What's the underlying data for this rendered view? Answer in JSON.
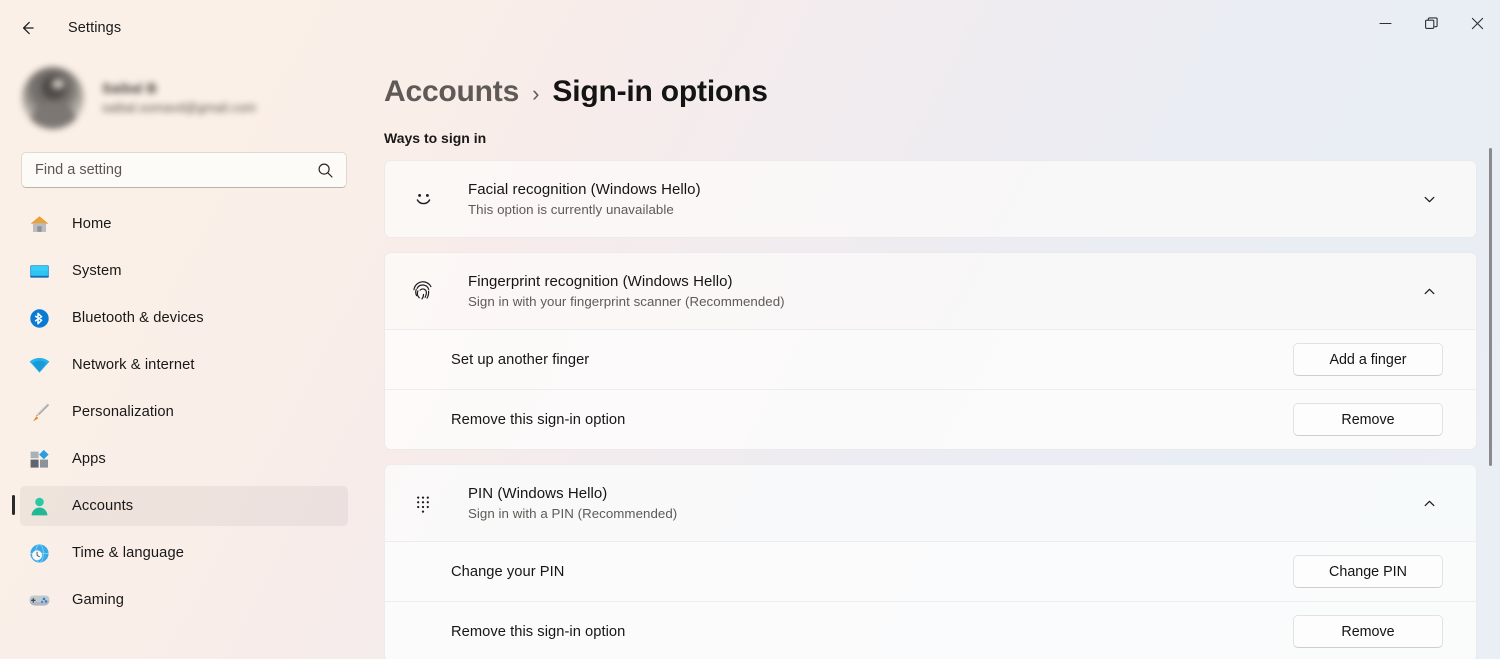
{
  "window": {
    "app_title": "Settings",
    "back_icon": "back-arrow-icon",
    "controls": {
      "minimize": "minimize-icon",
      "maximize": "restore-icon",
      "close": "close-icon"
    }
  },
  "sidebar": {
    "profile": {
      "name": "Saibal B",
      "email": "saibal.somavd@gmail.com",
      "avatar": "user-avatar"
    },
    "search": {
      "placeholder": "Find a setting",
      "value": "",
      "icon": "search-icon"
    },
    "items": [
      {
        "label": "Home",
        "icon": "home-icon",
        "selected": false
      },
      {
        "label": "System",
        "icon": "system-icon",
        "selected": false
      },
      {
        "label": "Bluetooth & devices",
        "icon": "bluetooth-icon",
        "selected": false
      },
      {
        "label": "Network & internet",
        "icon": "wifi-icon",
        "selected": false
      },
      {
        "label": "Personalization",
        "icon": "paintbrush-icon",
        "selected": false
      },
      {
        "label": "Apps",
        "icon": "apps-icon",
        "selected": false
      },
      {
        "label": "Accounts",
        "icon": "accounts-icon",
        "selected": true
      },
      {
        "label": "Time & language",
        "icon": "clock-globe-icon",
        "selected": false
      },
      {
        "label": "Gaming",
        "icon": "gamepad-icon",
        "selected": false
      }
    ]
  },
  "main": {
    "breadcrumb": {
      "parent": "Accounts",
      "separator": "›",
      "current": "Sign-in options"
    },
    "section_title": "Ways to sign in",
    "cards": [
      {
        "icon": "face-smile-icon",
        "title": "Facial recognition (Windows Hello)",
        "subtitle": "This option is currently unavailable",
        "expanded": false,
        "chevron": "chevron-down-icon",
        "rows": []
      },
      {
        "icon": "fingerprint-icon",
        "title": "Fingerprint recognition (Windows Hello)",
        "subtitle": "Sign in with your fingerprint scanner (Recommended)",
        "expanded": true,
        "chevron": "chevron-up-icon",
        "rows": [
          {
            "label": "Set up another finger",
            "button": "Add a finger"
          },
          {
            "label": "Remove this sign-in option",
            "button": "Remove"
          }
        ]
      },
      {
        "icon": "pin-keypad-icon",
        "title": "PIN (Windows Hello)",
        "subtitle": "Sign in with a PIN (Recommended)",
        "expanded": true,
        "chevron": "chevron-up-icon",
        "rows": [
          {
            "label": "Change your PIN",
            "button": "Change PIN"
          },
          {
            "label": "Remove this sign-in option",
            "button": "Remove"
          }
        ]
      }
    ]
  },
  "scrollbar": {
    "name": "vertical-scrollbar"
  },
  "colors": {
    "accent_selected_bar": "#2a2a2d",
    "bg_warm": "#fbf0e8",
    "bg_cool": "#eaeff5",
    "accounts_icon": "#26c0a0",
    "bluetooth_icon": "#0a7bd4",
    "text_primary": "#151515",
    "text_secondary": "#5e5a57"
  }
}
